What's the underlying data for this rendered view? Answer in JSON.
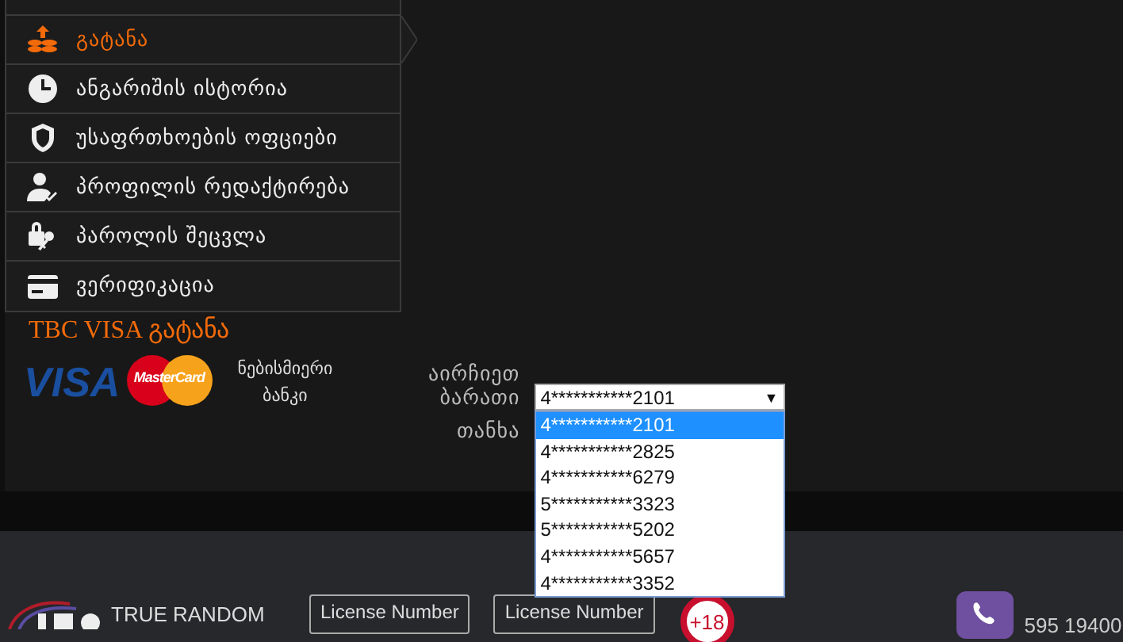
{
  "menu": {
    "items": [
      {
        "label": "გატანა",
        "selected": true
      },
      {
        "label": "ანგარიშის ისტორია",
        "selected": false
      },
      {
        "label": "უსაფრთხოების ოფციები",
        "selected": false
      },
      {
        "label": "პროფილის რედაქტირება",
        "selected": false
      },
      {
        "label": "პაროლის შეცვლა",
        "selected": false
      },
      {
        "label": "ვერიფიკაცია",
        "selected": false
      }
    ]
  },
  "withdraw": {
    "title": "TBC VISA გატანა",
    "logos": [
      "VISA",
      "MasterCard"
    ],
    "bank_note": "ნებისმიერი ბანკი",
    "card_label": "აირჩიეთ ბარათი",
    "amount_label": "თანხა",
    "card_select": {
      "value": "4***********2101",
      "arrow": "▼",
      "expanded": true,
      "options": [
        {
          "label": "4***********2101",
          "selected": true
        },
        {
          "label": "4***********2825",
          "selected": false
        },
        {
          "label": "4***********6279",
          "selected": false
        },
        {
          "label": "5***********3323",
          "selected": false
        },
        {
          "label": "5***********5202",
          "selected": false
        },
        {
          "label": "4***********5657",
          "selected": false
        },
        {
          "label": "4***********3352",
          "selected": false
        }
      ]
    }
  },
  "footer": {
    "brand": "TRUE RANDOM",
    "licenses": [
      "License Number",
      "License Number"
    ],
    "age_badge": "+18",
    "phone": "595 19400"
  }
}
